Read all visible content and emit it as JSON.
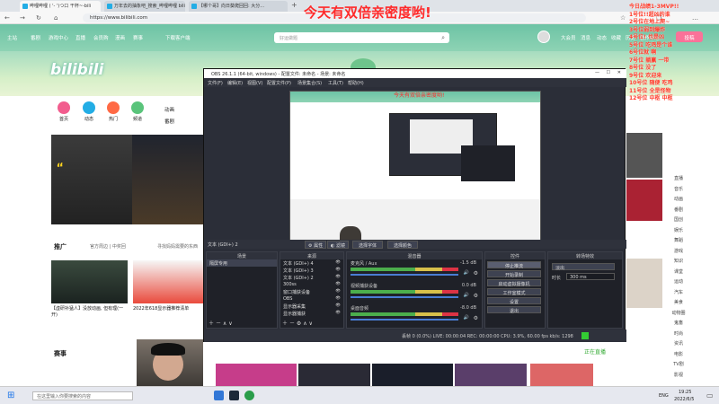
{
  "overlay_title": "今天有双倍亲密度哟!",
  "browser": {
    "tabs": [
      {
        "label": "哔哩哔哩 ( '- ')つ口 干杯~-bili"
      },
      {
        "label": "万年去的抽象吧_搜索_哔哩哔哩 bili"
      },
      {
        "label": "【哪个哥】向日葵爬回回: 大分..."
      }
    ],
    "url": "https://www.bilibili.com"
  },
  "bili": {
    "nav": [
      "主站",
      "番剧",
      "游戏中心",
      "直播",
      "会员购",
      "漫画",
      "赛事",
      "下载客户端"
    ],
    "search_placeholder": "好运做题",
    "right_nav": [
      "大会员",
      "消息",
      "动态",
      "收藏",
      "历史",
      "创作中心",
      "投稿"
    ],
    "logo": "bilibili",
    "channels": [
      {
        "label": "首页",
        "color": "#f25d8e"
      },
      {
        "label": "动态",
        "color": "#23ade5"
      },
      {
        "label": "热门",
        "color": "#ff6a45"
      },
      {
        "label": "频道",
        "color": "#5ac47b"
      }
    ],
    "sub_links": [
      "动画",
      "番剧"
    ],
    "promo_title": "推广",
    "promo_items": [
      "官方周边 | 中奖回",
      "不限次数 | 全新体验",
      "寻找妈妈需要的东西"
    ],
    "videos": [
      {
        "title": "【虚研补猛人】没放动画, 但有理(一开)",
        "color": "#33353a"
      },
      {
        "title": "2022年618显示器推荐清单",
        "color": "#e94a3c"
      }
    ],
    "section_events": "赛事",
    "live_section": "正在直播",
    "right_sidebar": [
      "直播",
      "音乐",
      "动画",
      "番剧",
      "国创",
      "娱乐",
      "舞蹈",
      "游戏",
      "知识",
      "课堂",
      "运动",
      "汽车",
      "美食",
      "动物圈",
      "鬼畜",
      "时尚",
      "资讯",
      "电影",
      "TV剧",
      "影视"
    ]
  },
  "obs": {
    "title": "OBS 26.1.1 (64-bit, windows) - 配置文件: 未命名 - 场景: 未命名",
    "menu": [
      "文件(F)",
      "编辑(E)",
      "视图(V)",
      "配置文件(P)",
      "场景集合(S)",
      "工具(T)",
      "帮助(H)"
    ],
    "source_label": "文本 (GDI+) 2",
    "source_buttons": [
      "属性",
      "滤镜",
      "选择字体",
      "选择颜色"
    ],
    "panels": {
      "scenes": "场景",
      "sources": "来源",
      "mixer": "混音器",
      "transitions": "转场",
      "controls": "控件",
      "transition_mode": "转场特效"
    },
    "scene_item": "隔屏专用",
    "sources_list": [
      "文本 (GDI+) 4",
      "文本 (GDI+) 3",
      "文本 (GDI+) 2",
      "300ss",
      "窗口捕获设备",
      "OBS",
      "显示器采集",
      "显示器捕获"
    ],
    "mixer_tracks": [
      {
        "name": "麦克风 / Aux",
        "db": "-1.5 dB"
      },
      {
        "name": "视频捕获设备",
        "db": "0.0 dB"
      },
      {
        "name": "桌面音频",
        "db": "-8.0 dB"
      }
    ],
    "controls": [
      "停止推流",
      "开始录制",
      "启动虚拟摄像机",
      "工作室模式",
      "设置",
      "退出"
    ],
    "transition_type": "淡出",
    "duration_label": "时长",
    "duration_value": "300 ms",
    "status": "丢帧 0 (0.0%)   LIVE: 00:00:04   REC: 00:00:00   CPU: 3.9%, 60.00 fps   kb/s: 1298"
  },
  "danmaku": [
    {
      "text": "今日战绩1-3MVP!!",
      "color": "#ff3b2a"
    },
    {
      "text": "1号位!!超凶的谁",
      "color": "#ff3b2a"
    },
    {
      "text": "2号位在地上爬~",
      "color": "#ff3b2a"
    },
    {
      "text": "3号位弱到爆炸",
      "color": "#ff3b2a"
    },
    {
      "text": "4号位! 也是凶",
      "color": "#ff3b2a"
    },
    {
      "text": "5号位 吃鸡是个谁",
      "color": "#ff3b2a"
    },
    {
      "text": "6号位就 啊",
      "color": "#ff3b2a"
    },
    {
      "text": "7号位 躺赢 一带",
      "color": "#ff3b2a"
    },
    {
      "text": "8号位 没了",
      "color": "#ff3b2a"
    },
    {
      "text": "9号位 欢迎来",
      "color": "#ff3b2a"
    },
    {
      "text": "10号位 随便 吃鸡",
      "color": "#ff3b2a"
    },
    {
      "text": "11号位 全是怪物",
      "color": "#ff3b2a"
    },
    {
      "text": "12号位 中枢 中枢",
      "color": "#ff3b2a"
    }
  ],
  "taskbar": {
    "search_placeholder": "在这里输入你要搜索的内容",
    "time": "19:25",
    "date": "2022/6/5",
    "lang": "ENG"
  }
}
